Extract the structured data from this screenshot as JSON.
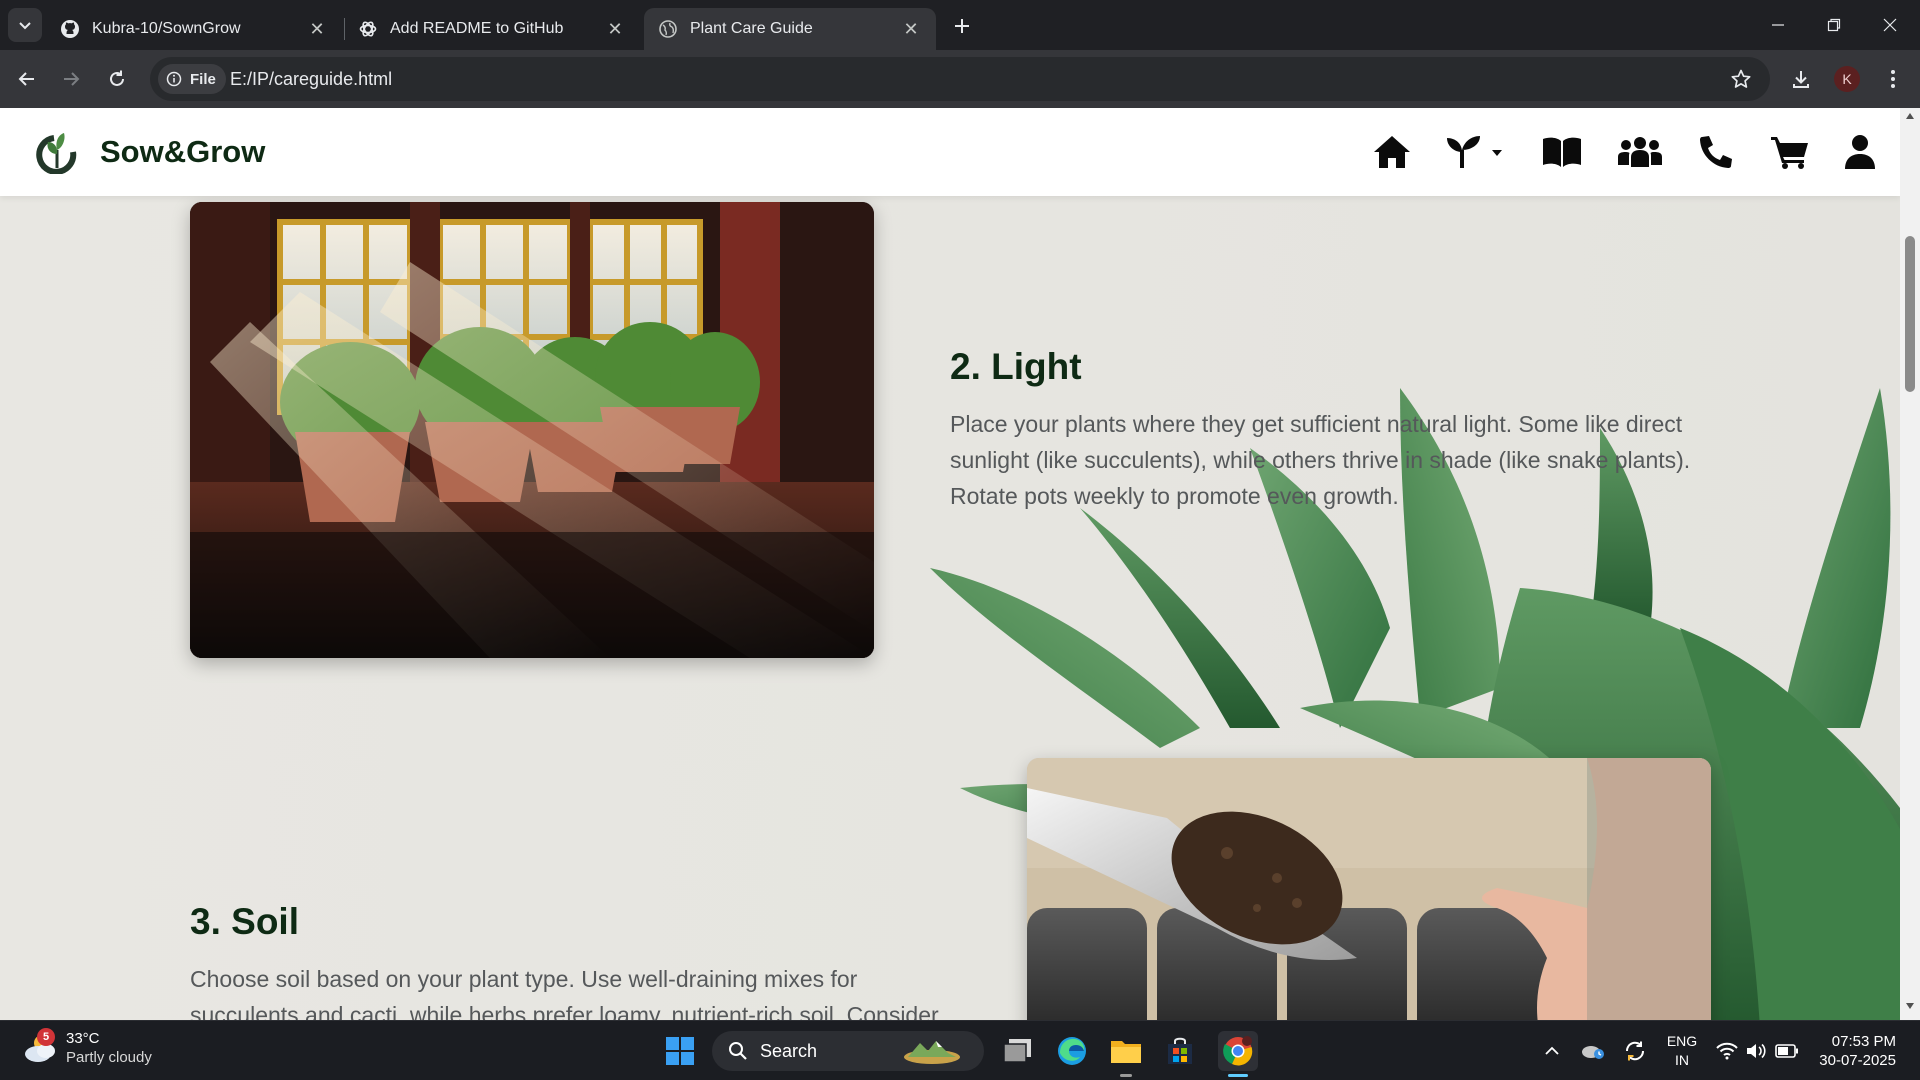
{
  "browser": {
    "tabs": [
      {
        "title": "Kubra-10/SownGrow",
        "icon": "github-icon"
      },
      {
        "title": "Add README to GitHub",
        "icon": "openai-icon"
      },
      {
        "title": "Plant Care Guide",
        "icon": "globe-icon",
        "active": true
      }
    ],
    "address_chip": "File",
    "url": "E:/IP/careguide.html",
    "profile_initial": "K"
  },
  "site": {
    "brand": "Sow&Grow",
    "nav_icons": [
      "home-icon",
      "plants-dropdown-icon",
      "guide-book-icon",
      "community-icon",
      "phone-icon",
      "cart-icon",
      "user-icon"
    ],
    "brand_color": "#0e2a14"
  },
  "sections": [
    {
      "title": "2. Light",
      "text": "Place your plants where they get sufficient natural light. Some like direct sunlight (like succulents), while others thrive in shade (like snake plants). Rotate pots weekly to promote even growth."
    },
    {
      "title": "3. Soil",
      "text": "Choose soil based on your plant type. Use well-draining mixes for succulents and cacti, while herbs prefer loamy, nutrient-rich soil. Consider"
    }
  ],
  "taskbar": {
    "weather_temp": "33°C",
    "weather_cond": "Partly cloudy",
    "weather_badge": "5",
    "search_label": "Search",
    "lang_line1": "ENG",
    "lang_line2": "IN",
    "time": "07:53 PM",
    "date": "30-07-2025"
  }
}
